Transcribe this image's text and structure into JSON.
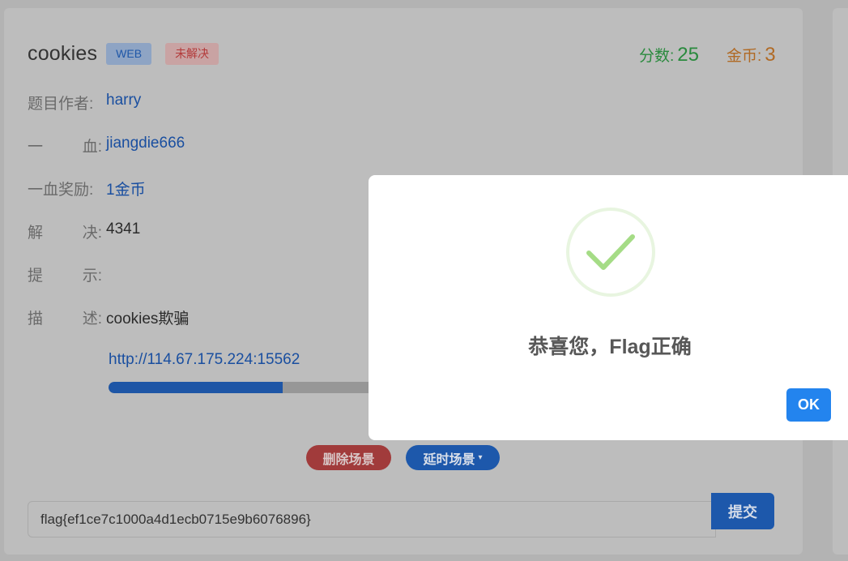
{
  "challenge": {
    "title": "cookies",
    "category_badge": "WEB",
    "status_badge": "未解决",
    "score_label": "分数:",
    "score_value": "25",
    "coin_label": "金币:",
    "coin_value": "3"
  },
  "details": [
    {
      "label_chars": [
        "题目作者:"
      ],
      "value": "harry",
      "style": "link"
    },
    {
      "label_chars": [
        "一",
        "血:"
      ],
      "value": "jiangdie666",
      "style": "link"
    },
    {
      "label_chars": [
        "一血奖励:"
      ],
      "value": "1金币",
      "style": "link"
    },
    {
      "label_chars": [
        "解",
        "决:"
      ],
      "value": "4341",
      "style": "plain"
    },
    {
      "label_chars": [
        "提",
        "示:"
      ],
      "value": "",
      "style": "plain"
    },
    {
      "label_chars": [
        "描",
        "述:"
      ],
      "value": "cookies欺骗",
      "style": "plain"
    }
  ],
  "scene": {
    "url": "http://114.67.175.224:15562",
    "progress": 0.65,
    "delete_label": "删除场景",
    "delay_label": "延时场景",
    "delay_caret": "▾"
  },
  "submit": {
    "flag_value": "flag{ef1ce7c1000a4d1ecb0715e9b6076896}",
    "submit_label": "提交"
  },
  "modal": {
    "message": "恭喜您，Flag正确",
    "ok_label": "OK",
    "icon": "success-checkmark-icon",
    "colors": {
      "check": "#a5dc86",
      "ring": "#e8f5e0",
      "ok_button": "#2384ee"
    }
  }
}
